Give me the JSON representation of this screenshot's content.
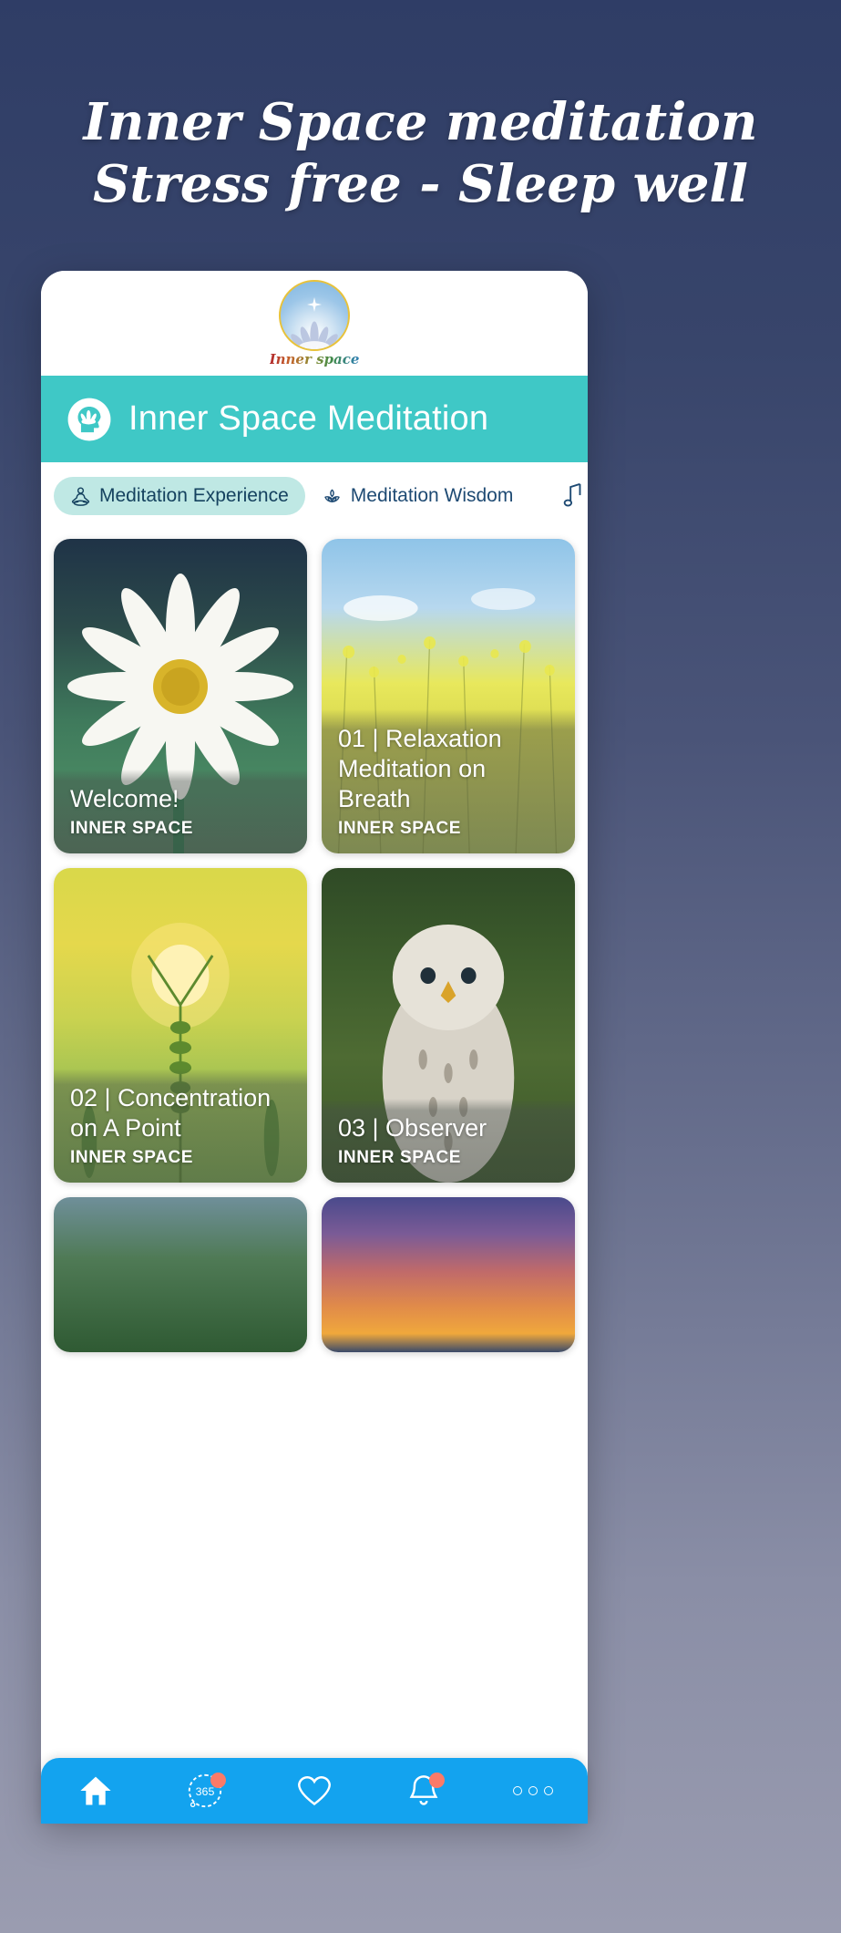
{
  "promo": {
    "line1": "Inner Space meditation",
    "line2": "Stress free - Sleep well"
  },
  "logo": {
    "wordmark": "Inner space",
    "star_icon": "star-icon",
    "lotus_icon": "lotus-icon"
  },
  "appbar": {
    "title": "Inner Space Meditation",
    "icon": "head-lotus-icon",
    "bg_color": "#3fc8c6"
  },
  "tabs": [
    {
      "label": "Meditation Experience",
      "icon": "meditating-person-icon",
      "active": true
    },
    {
      "label": "Meditation Wisdom",
      "icon": "lotus-icon",
      "active": false
    },
    {
      "label": "",
      "icon": "music-note-icon",
      "active": false
    }
  ],
  "cards": [
    {
      "title": "Welcome!",
      "subtitle": "INNER SPACE",
      "art": "art-daisy",
      "name": "card-welcome"
    },
    {
      "title": "01 | Relaxation Meditation on Breath",
      "subtitle": "INNER SPACE",
      "art": "art-canola",
      "name": "card-01-relaxation"
    },
    {
      "title": "02 | Concentration on A Point",
      "subtitle": "INNER SPACE",
      "art": "art-wheat",
      "name": "card-02-concentration"
    },
    {
      "title": "03 | Observer",
      "subtitle": "INNER SPACE",
      "art": "art-owl",
      "name": "card-03-observer"
    },
    {
      "title": "",
      "subtitle": "",
      "art": "art-leaf",
      "name": "card-04-partial"
    },
    {
      "title": "",
      "subtitle": "",
      "art": "art-sunset",
      "name": "card-05-partial"
    }
  ],
  "bottomnav": {
    "bg_color": "#13a3ef",
    "badge_color": "#fb7a68",
    "items": [
      {
        "name": "nav-home",
        "icon": "home-icon",
        "badge": false,
        "label": ""
      },
      {
        "name": "nav-365",
        "icon": "daily-365-icon",
        "badge": true,
        "label": "365"
      },
      {
        "name": "nav-favorites",
        "icon": "heart-icon",
        "badge": false,
        "label": ""
      },
      {
        "name": "nav-notifications",
        "icon": "bell-icon",
        "badge": true,
        "label": ""
      },
      {
        "name": "nav-more",
        "icon": "more-dots-icon",
        "badge": false,
        "label": ""
      }
    ]
  }
}
